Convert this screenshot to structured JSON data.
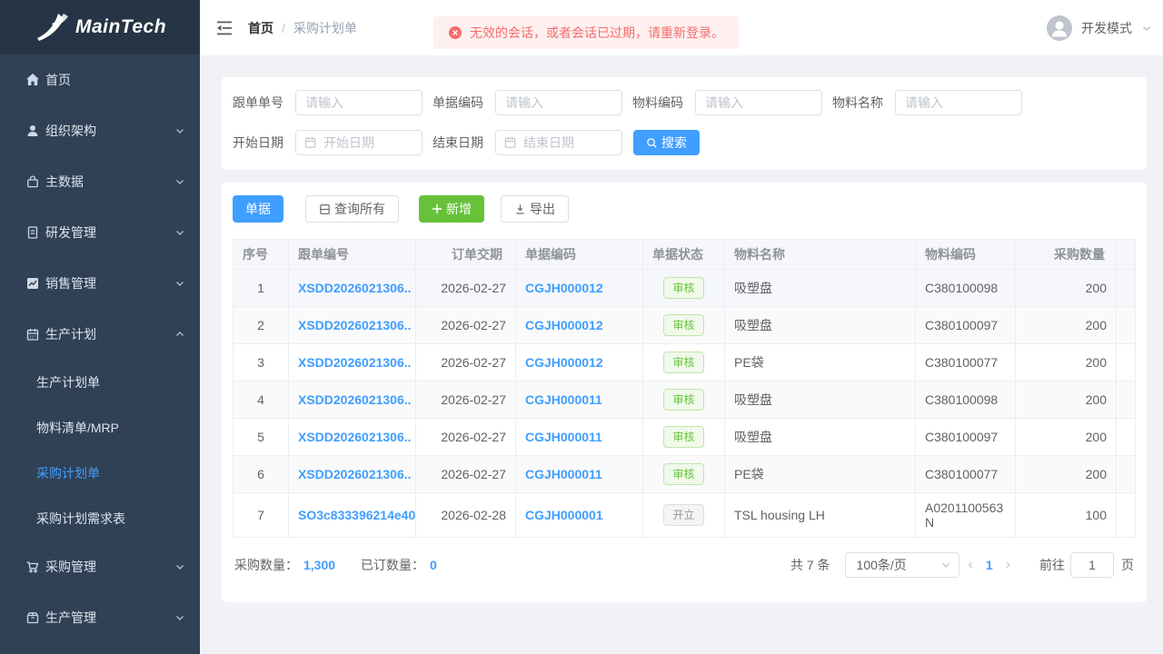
{
  "colors": {
    "primary": "#409eff",
    "success": "#67c23a",
    "danger": "#f56c6c",
    "sidebar_bg": "#304156",
    "sidebar_logo_bg": "#263445",
    "page_bg": "#f0f2f5",
    "badge_success_text": "#67c23a",
    "badge_info_text": "#909399"
  },
  "brand": {
    "name": "MainTech"
  },
  "sidebar": {
    "items": [
      {
        "label": "首页",
        "icon": "home-icon"
      },
      {
        "label": "组织架构",
        "icon": "user-icon"
      },
      {
        "label": "主数据",
        "icon": "bag-icon"
      },
      {
        "label": "研发管理",
        "icon": "document-icon"
      },
      {
        "label": "销售管理",
        "icon": "chart-icon"
      },
      {
        "label": "生产计划",
        "icon": "calendar-icon"
      },
      {
        "label": "采购管理",
        "icon": "cart-icon"
      },
      {
        "label": "生产管理",
        "icon": "box-icon"
      }
    ],
    "submenu": [
      {
        "label": "生产计划单",
        "active": false
      },
      {
        "label": "物料清单/MRP",
        "active": false
      },
      {
        "label": "采购计划单",
        "active": true
      },
      {
        "label": "采购计划需求表",
        "active": false
      }
    ]
  },
  "header": {
    "breadcrumb": {
      "home": "首页",
      "separator": "/",
      "current": "采购计划单"
    },
    "alert_message": "无效的会话，或者会话已过期，请重新登录。",
    "user_label": "开发模式"
  },
  "filters": {
    "fields": [
      {
        "label": "跟单单号",
        "placeholder": "请输入"
      },
      {
        "label": "单据编码",
        "placeholder": "请输入"
      },
      {
        "label": "物料编码",
        "placeholder": "请输入"
      },
      {
        "label": "物料名称",
        "placeholder": "请输入"
      }
    ],
    "date_fields": [
      {
        "label": "开始日期",
        "placeholder": "开始日期"
      },
      {
        "label": "结束日期",
        "placeholder": "结束日期"
      }
    ],
    "search_label": "搜索"
  },
  "toolbar": {
    "doc_label": "单据",
    "query_all_label": "查询所有",
    "add_label": "新增",
    "export_label": "导出"
  },
  "table": {
    "columns": [
      "序号",
      "跟单编号",
      "订单交期",
      "单据编码",
      "单据状态",
      "物料名称",
      "物料编码",
      "采购数量"
    ],
    "rows": [
      {
        "seq": "1",
        "order_no": "XSDD2026021306..",
        "delivery_date": "2026-02-27",
        "doc_no": "CGJH000012",
        "status": "审核",
        "status_type": "success",
        "material_name": "吸塑盘",
        "material_code": "C380100098",
        "qty": "200"
      },
      {
        "seq": "2",
        "order_no": "XSDD2026021306..",
        "delivery_date": "2026-02-27",
        "doc_no": "CGJH000012",
        "status": "审核",
        "status_type": "success",
        "material_name": "吸塑盘",
        "material_code": "C380100097",
        "qty": "200"
      },
      {
        "seq": "3",
        "order_no": "XSDD2026021306..",
        "delivery_date": "2026-02-27",
        "doc_no": "CGJH000012",
        "status": "审核",
        "status_type": "success",
        "material_name": "PE袋",
        "material_code": "C380100077",
        "qty": "200"
      },
      {
        "seq": "4",
        "order_no": "XSDD2026021306..",
        "delivery_date": "2026-02-27",
        "doc_no": "CGJH000011",
        "status": "审核",
        "status_type": "success",
        "material_name": "吸塑盘",
        "material_code": "C380100098",
        "qty": "200"
      },
      {
        "seq": "5",
        "order_no": "XSDD2026021306..",
        "delivery_date": "2026-02-27",
        "doc_no": "CGJH000011",
        "status": "审核",
        "status_type": "success",
        "material_name": "吸塑盘",
        "material_code": "C380100097",
        "qty": "200"
      },
      {
        "seq": "6",
        "order_no": "XSDD2026021306..",
        "delivery_date": "2026-02-27",
        "doc_no": "CGJH000011",
        "status": "审核",
        "status_type": "success",
        "material_name": "PE袋",
        "material_code": "C380100077",
        "qty": "200"
      },
      {
        "seq": "7",
        "order_no": "SO3c833396214e40",
        "delivery_date": "2026-02-28",
        "doc_no": "CGJH000001",
        "status": "开立",
        "status_type": "info",
        "material_name": "TSL housing LH",
        "material_code": "A0201100563N",
        "qty": "100"
      }
    ]
  },
  "summary": {
    "purchase_qty_label": "采购数量：",
    "purchase_qty": "1,300",
    "ordered_qty_label": "已订数量：",
    "ordered_qty": "0"
  },
  "pagination": {
    "total_label": "共 7 条",
    "page_size": "100条/页",
    "prev": "‹",
    "current_page": "1",
    "next": "›",
    "goto_label": "前往",
    "goto_value": "1",
    "page_unit_label": "页"
  }
}
